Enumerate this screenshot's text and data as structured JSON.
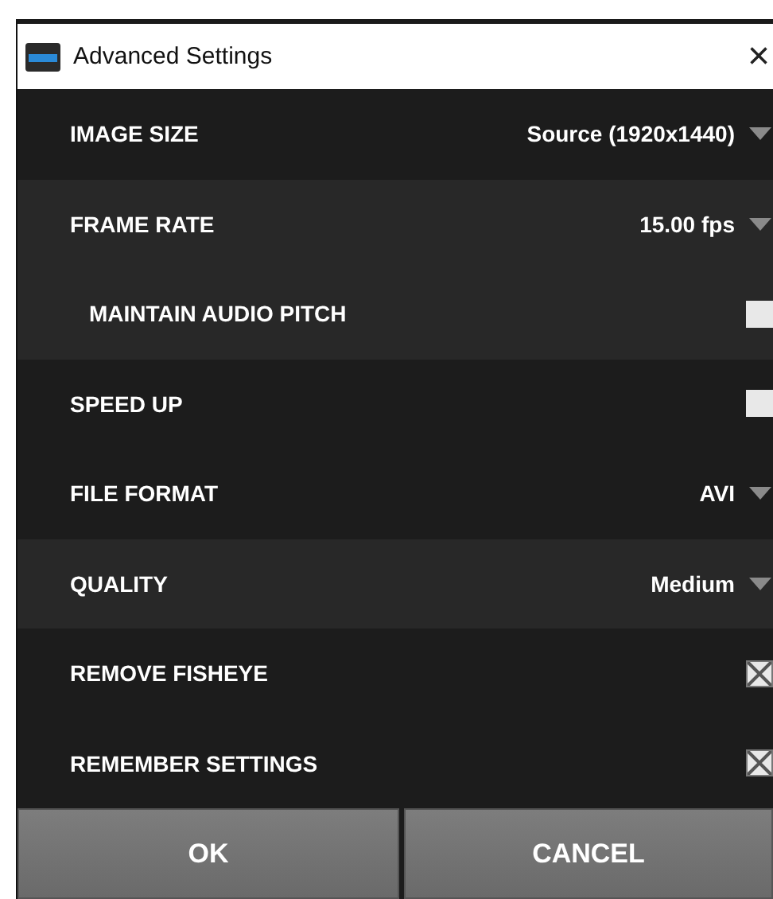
{
  "window": {
    "title": "Advanced Settings",
    "close": "×"
  },
  "rows": [
    {
      "kind": "dropdown",
      "label": "IMAGE SIZE",
      "value": "Source (1920x1440)",
      "highlighted": false,
      "indented": false
    },
    {
      "kind": "dropdown",
      "label": "FRAME RATE",
      "value": "15.00 fps",
      "highlighted": true,
      "indented": false
    },
    {
      "kind": "checkbox",
      "label": "MAINTAIN AUDIO PITCH",
      "checked": false,
      "highlighted": true,
      "indented": true
    },
    {
      "kind": "checkbox",
      "label": "SPEED UP",
      "checked": false,
      "highlighted": false,
      "indented": false
    },
    {
      "kind": "dropdown",
      "label": "FILE FORMAT",
      "value": "AVI",
      "highlighted": false,
      "indented": false
    },
    {
      "kind": "dropdown",
      "label": "QUALITY",
      "value": "Medium",
      "highlighted": true,
      "indented": false
    },
    {
      "kind": "checkbox",
      "label": "REMOVE FISHEYE",
      "checked": true,
      "highlighted": false,
      "indented": false
    },
    {
      "kind": "checkbox",
      "label": "REMEMBER SETTINGS",
      "checked": true,
      "highlighted": false,
      "indented": false
    }
  ],
  "buttons": [
    "OK",
    "CANCEL"
  ]
}
